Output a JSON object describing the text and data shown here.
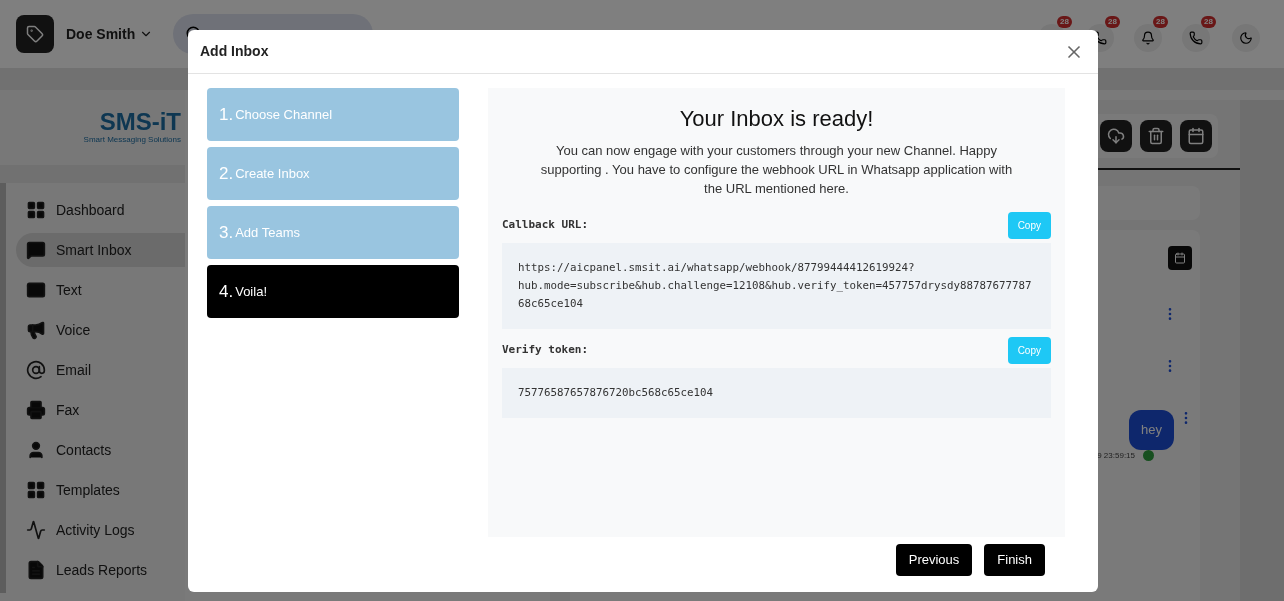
{
  "header": {
    "user_name": "Doe Smith",
    "notification_badges": [
      "28",
      "28",
      "28",
      "28"
    ]
  },
  "sidebar": {
    "logo": "SMS-iT",
    "logo_tagline": "Smart Messaging Solutions",
    "items": [
      {
        "label": "Dashboard",
        "selected": false
      },
      {
        "label": "Smart Inbox",
        "selected": true
      },
      {
        "label": "Text",
        "selected": false
      },
      {
        "label": "Voice",
        "selected": false
      },
      {
        "label": "Email",
        "selected": false
      },
      {
        "label": "Fax",
        "selected": false
      },
      {
        "label": "Contacts",
        "selected": false
      },
      {
        "label": "Templates",
        "selected": false
      },
      {
        "label": "Activity Logs",
        "selected": false
      },
      {
        "label": "Leads Reports",
        "selected": false
      }
    ]
  },
  "conversation": {
    "messages": [
      {
        "text": "hey",
        "time": "9 23:59:15"
      }
    ]
  },
  "dialog": {
    "title": "Add Inbox",
    "steps": [
      {
        "number": "1.",
        "label": "Choose Channel",
        "selected": false
      },
      {
        "number": "2.",
        "label": "Create Inbox",
        "selected": false
      },
      {
        "number": "3.",
        "label": "Add Teams",
        "selected": false
      },
      {
        "number": "4.",
        "label": "Voila!",
        "selected": true
      }
    ],
    "heading": "Your Inbox is ready!",
    "message": "You can now engage with your customers through your new Channel. Happy supporting . You have to configure the webhook URL in Whatsapp application with the URL mentioned here.",
    "fields": [
      {
        "label": "Callback URL:",
        "value": "https://aicpanel.smsit.ai/whatsapp/webhook/87799444412619924?hub.mode=subscribe&hub.challenge=12108&hub.verify_token=457757drysdy8878767778768c65ce104",
        "button": "Copy"
      },
      {
        "label": "Verify token:",
        "value": "75776587657876720bc568c65ce104",
        "button": "Copy"
      }
    ],
    "buttons": [
      "Previous",
      "Finish"
    ]
  }
}
